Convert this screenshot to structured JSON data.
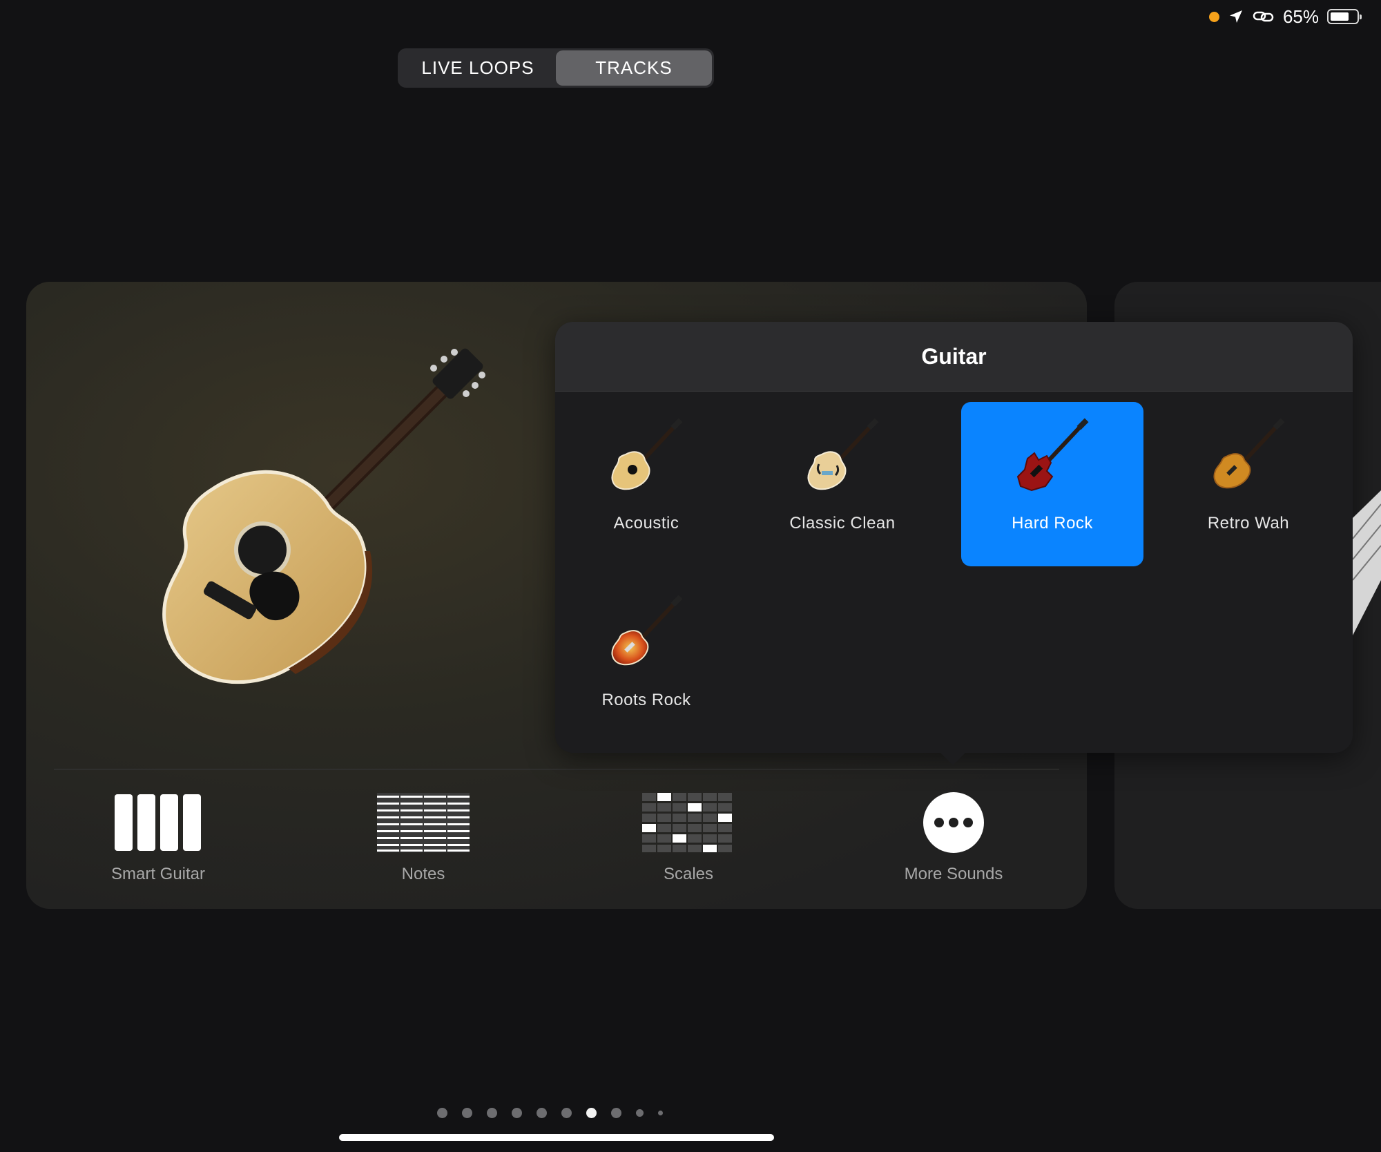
{
  "status": {
    "battery_pct": "65%",
    "battery_level": 0.65
  },
  "segmented": {
    "options": [
      "LIVE LOOPS",
      "TRACKS"
    ],
    "selected": "TRACKS"
  },
  "instrument": {
    "tools": [
      {
        "label": "Smart Guitar",
        "icon": "smart-guitar-icon"
      },
      {
        "label": "Notes",
        "icon": "notes-icon"
      },
      {
        "label": "Scales",
        "icon": "scales-icon"
      },
      {
        "label": "More Sounds",
        "icon": "more-icon"
      }
    ]
  },
  "popover": {
    "title": "Guitar",
    "sounds": [
      {
        "label": "Acoustic",
        "selected": false
      },
      {
        "label": "Classic Clean",
        "selected": false
      },
      {
        "label": "Hard Rock",
        "selected": true
      },
      {
        "label": "Retro Wah",
        "selected": false
      },
      {
        "label": "Roots Rock",
        "selected": false
      }
    ]
  },
  "pager": {
    "count": 10,
    "current": 7
  },
  "colors": {
    "accent": "#0a84ff",
    "background": "#121214",
    "status_dot": "#f7a21b"
  }
}
